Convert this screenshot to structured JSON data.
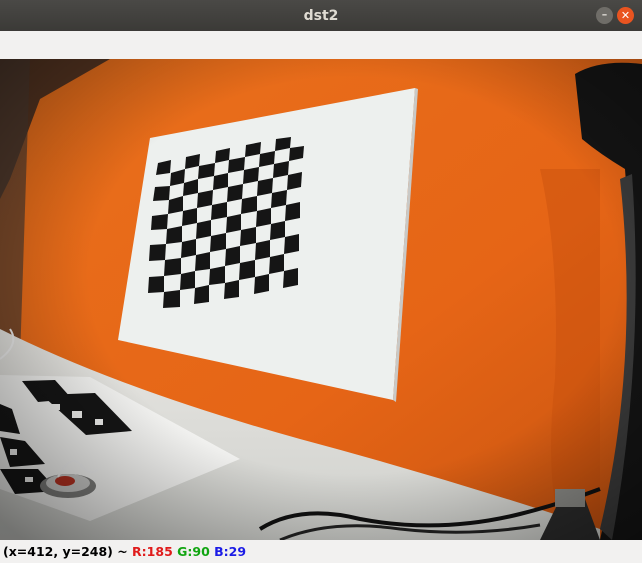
{
  "window": {
    "title": "dst2"
  },
  "controls": {
    "minimize_glyph": "–",
    "close_glyph": "✕"
  },
  "status": {
    "coords": "(x=412, y=248) ~ ",
    "r": "R:185",
    "g": "G:90",
    "b": "B:29"
  },
  "image": {
    "description_colors": {
      "wall": "#e86a18",
      "paper": "#eef0ee",
      "squares": "#151515"
    }
  }
}
